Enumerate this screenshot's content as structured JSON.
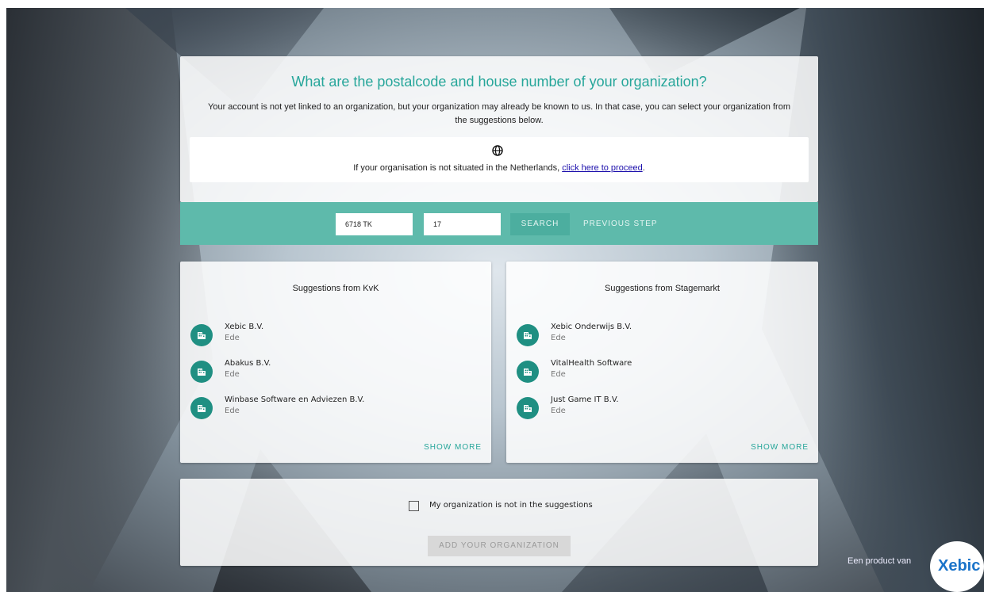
{
  "header": {
    "title": "What are the postalcode and house number of your organization?",
    "intro": "Your account is not yet linked to an organization, but your organization may already be known to us. In that case, you can select your organization from the suggestions below."
  },
  "notice": {
    "icon": "globe-icon",
    "text_before": "If your organisation is not situated in the Netherlands, ",
    "link_text": "click here to proceed",
    "text_after": "."
  },
  "search": {
    "postalcode_value": "6718 TK",
    "housenumber_value": "17",
    "search_label": "SEARCH",
    "previous_label": "PREVIOUS STEP"
  },
  "kvk": {
    "title": "Suggestions from KvK",
    "items": [
      {
        "name": "Xebic B.V.",
        "city": "Ede"
      },
      {
        "name": "Abakus B.V.",
        "city": "Ede"
      },
      {
        "name": "Winbase Software en Adviezen B.V.",
        "city": "Ede"
      }
    ],
    "show_more": "SHOW MORE"
  },
  "stagemarkt": {
    "title": "Suggestions from Stagemarkt",
    "items": [
      {
        "name": "Xebic Onderwijs B.V.",
        "city": "Ede"
      },
      {
        "name": "VitalHealth Software",
        "city": "Ede"
      },
      {
        "name": "Just Game IT B.V.",
        "city": "Ede"
      }
    ],
    "show_more": "SHOW MORE"
  },
  "bottom": {
    "checkbox_label": "My organization is not in the suggestions",
    "checked": false,
    "add_label": "ADD YOUR ORGANIZATION"
  },
  "brand": {
    "tagline": "Een product van",
    "logo_text": "Xebic"
  },
  "colors": {
    "accent": "#26a69a",
    "bar": "#5ebaab",
    "avatar": "#1f8f82"
  }
}
